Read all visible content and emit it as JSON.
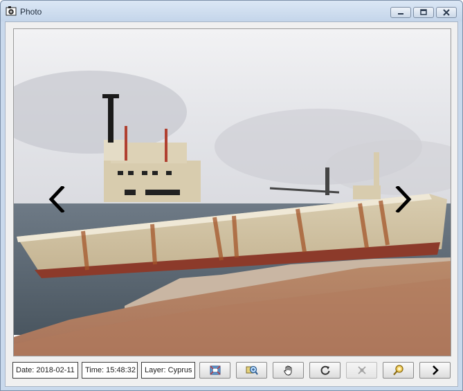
{
  "window": {
    "title": "Photo",
    "icon": "photo-app-icon",
    "controls": [
      "minimize-icon",
      "maximize-icon",
      "close-icon"
    ]
  },
  "photo": {
    "subject": "ship-photo",
    "prev_icon": "chevron-left-icon",
    "next_icon": "chevron-right-icon"
  },
  "status": {
    "date": "Date: 2018-02-11",
    "time": "Time: 15:48:32",
    "layer": "Layer: Cyprus"
  },
  "toolbar": [
    {
      "icon": "zoom-extent-icon",
      "enabled": true
    },
    {
      "icon": "zoom-in-icon",
      "enabled": true
    },
    {
      "icon": "pan-hand-icon",
      "enabled": true
    },
    {
      "icon": "rotate-icon",
      "enabled": true
    },
    {
      "icon": "remove-icon",
      "enabled": false
    },
    {
      "icon": "locate-icon",
      "enabled": true
    },
    {
      "icon": "next-arrow-icon",
      "enabled": true
    }
  ]
}
